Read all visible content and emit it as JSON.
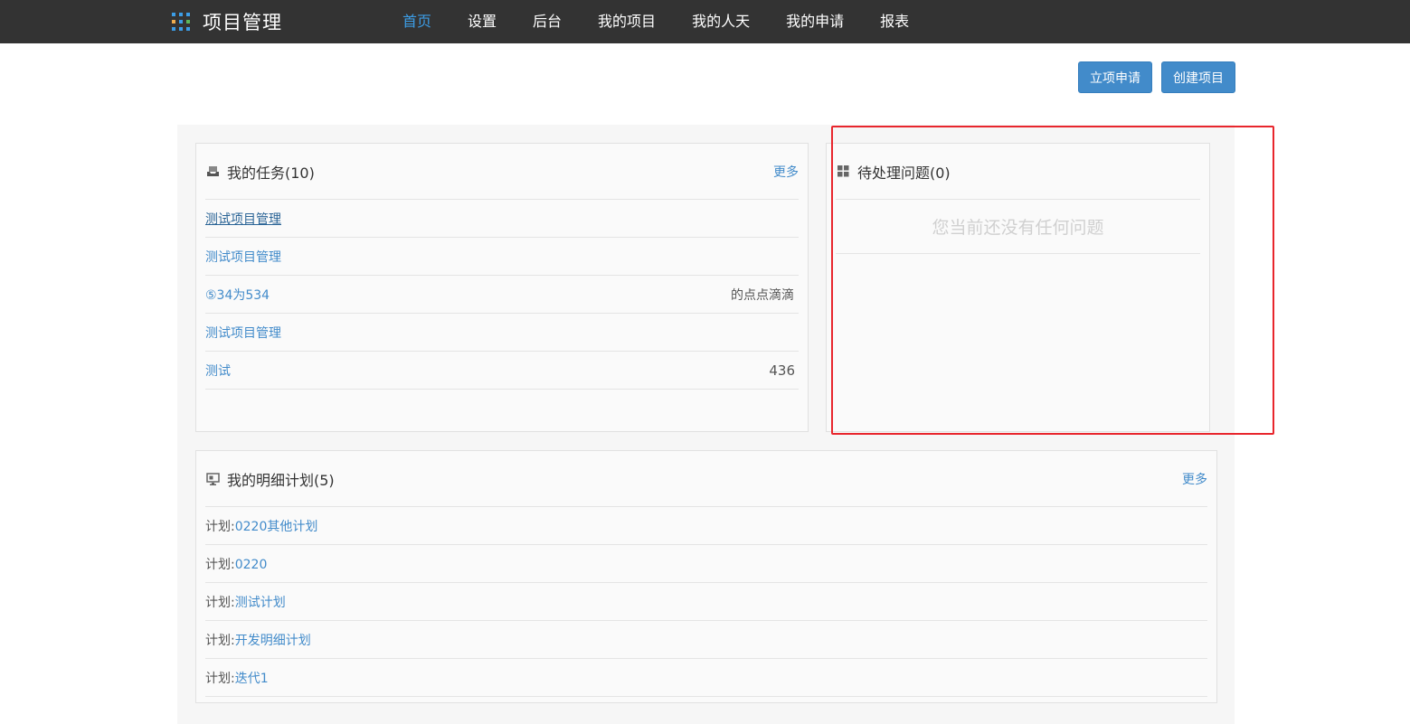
{
  "app": {
    "title": "项目管理",
    "logo_colors": [
      "#3c9de6",
      "#3c9de6",
      "#3c9de6",
      "#f0ad4e",
      "#3c9de6",
      "#5cb85c",
      "#3c9de6",
      "#3c9de6",
      "#3c9de6"
    ]
  },
  "nav": {
    "items": [
      {
        "label": "首页",
        "active": true
      },
      {
        "label": "设置",
        "active": false
      },
      {
        "label": "后台",
        "active": false
      },
      {
        "label": "我的项目",
        "active": false
      },
      {
        "label": "我的人天",
        "active": false
      },
      {
        "label": "我的申请",
        "active": false
      },
      {
        "label": "报表",
        "active": false
      }
    ]
  },
  "toolbar": {
    "apply_label": "立项申请",
    "create_label": "创建项目"
  },
  "tasks": {
    "icon": "inbox-icon",
    "title": "我的任务(10)",
    "more": "更多",
    "rows": [
      {
        "name": "测试项目管理",
        "right": ""
      },
      {
        "name": "测试项目管理",
        "right": ""
      },
      {
        "name": "⑤34为534",
        "right": "的点点滴滴"
      },
      {
        "name": "测试项目管理",
        "right": ""
      },
      {
        "name": "测试",
        "right": "436"
      }
    ]
  },
  "issues": {
    "icon": "grid-icon",
    "title": "待处理问题(0)",
    "empty_text": "您当前还没有任何问题"
  },
  "plans": {
    "icon": "monitor-icon",
    "title": "我的明细计划(5)",
    "more": "更多",
    "prefix": "计划:",
    "rows": [
      {
        "name": "0220其他计划"
      },
      {
        "name": "0220"
      },
      {
        "name": "测试计划"
      },
      {
        "name": "开发明细计划"
      },
      {
        "name": "迭代1"
      }
    ]
  },
  "colors": {
    "navbar": "#333333",
    "accent": "#428bca",
    "active_nav": "#3c9de6",
    "highlight": "#e8262d"
  }
}
